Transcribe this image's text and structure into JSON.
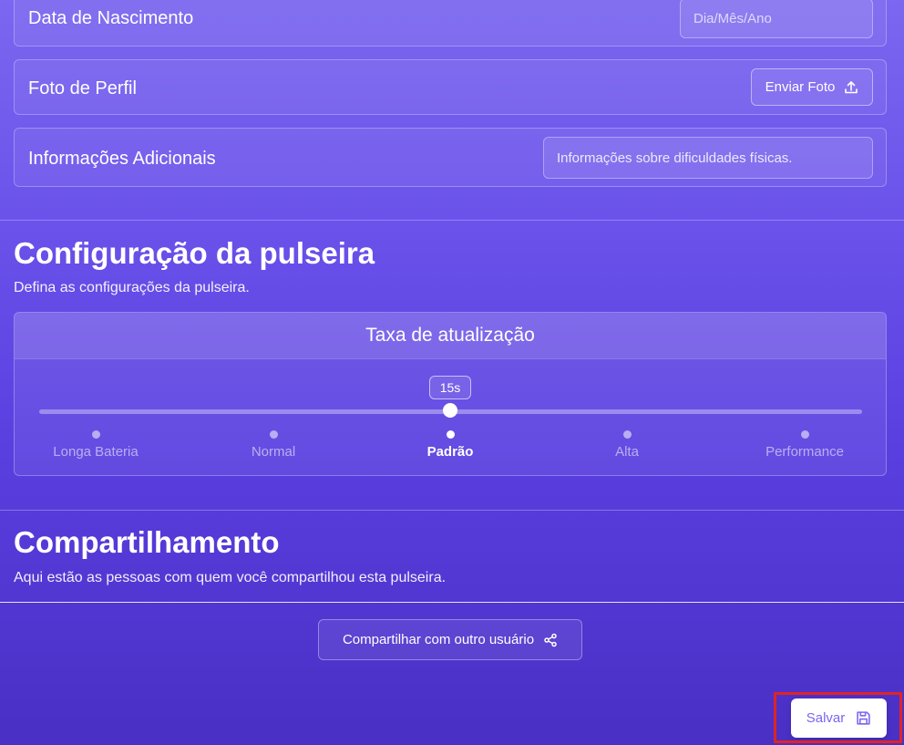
{
  "profile": {
    "birth_label": "Data de Nascimento",
    "birth_placeholder": "Dia/Mês/Ano",
    "photo_label": "Foto de Perfil",
    "photo_button": "Enviar Foto",
    "extra_label": "Informações Adicionais",
    "extra_value": "Informações sobre dificuldades físicas."
  },
  "bracelet": {
    "title": "Configuração da pulseira",
    "subtitle": "Defina as configurações da pulseira.",
    "card_title": "Taxa de atualização",
    "slider_value": "15s",
    "selected_index": 2,
    "marks": [
      "Longa Bateria",
      "Normal",
      "Padrão",
      "Alta",
      "Performance"
    ]
  },
  "sharing": {
    "title": "Compartilhamento",
    "subtitle": "Aqui estão as pessoas com quem você compartilhou esta pulseira.",
    "share_button": "Compartilhar com outro usuário"
  },
  "actions": {
    "save_label": "Salvar"
  },
  "icons": {
    "upload": "upload-icon",
    "share": "share-icon",
    "save": "floppy-disk-icon"
  },
  "colors": {
    "highlight": "#e02424",
    "save_text": "#7b67f0"
  }
}
